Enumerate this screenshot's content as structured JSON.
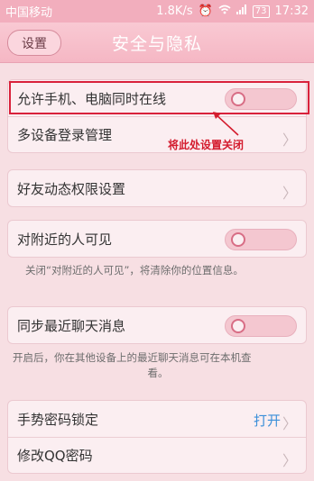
{
  "status_bar": {
    "carrier": "中国移动",
    "speed": "1.8K/s",
    "battery": "73",
    "time": "17:32"
  },
  "header": {
    "back_label": "设置",
    "title": "安全与隐私"
  },
  "group1": {
    "item1_label": "允许手机、电脑同时在线",
    "item1_toggle": "off",
    "item2_label": "多设备登录管理"
  },
  "annotation": "将此处设置关闭",
  "group2": {
    "item_label": "好友动态权限设置"
  },
  "group3": {
    "item_label": "对附近的人可见",
    "toggle": "off",
    "hint": "关闭“对附近的人可见”，将清除你的位置信息。"
  },
  "group4": {
    "item_label": "同步最近聊天消息",
    "toggle": "off",
    "hint_line1": "开启后，你在其他设备上的最近聊天消息可在本机查",
    "hint_line2": "看。"
  },
  "group5": {
    "item1_label": "手势密码锁定",
    "item1_value": "打开",
    "item2_label": "修改QQ密码"
  },
  "colors": {
    "header_bg": "#f5b7c4",
    "page_bg": "#f7dfe3",
    "annotation": "#d41c2e",
    "link_blue": "#3b8fd9"
  }
}
